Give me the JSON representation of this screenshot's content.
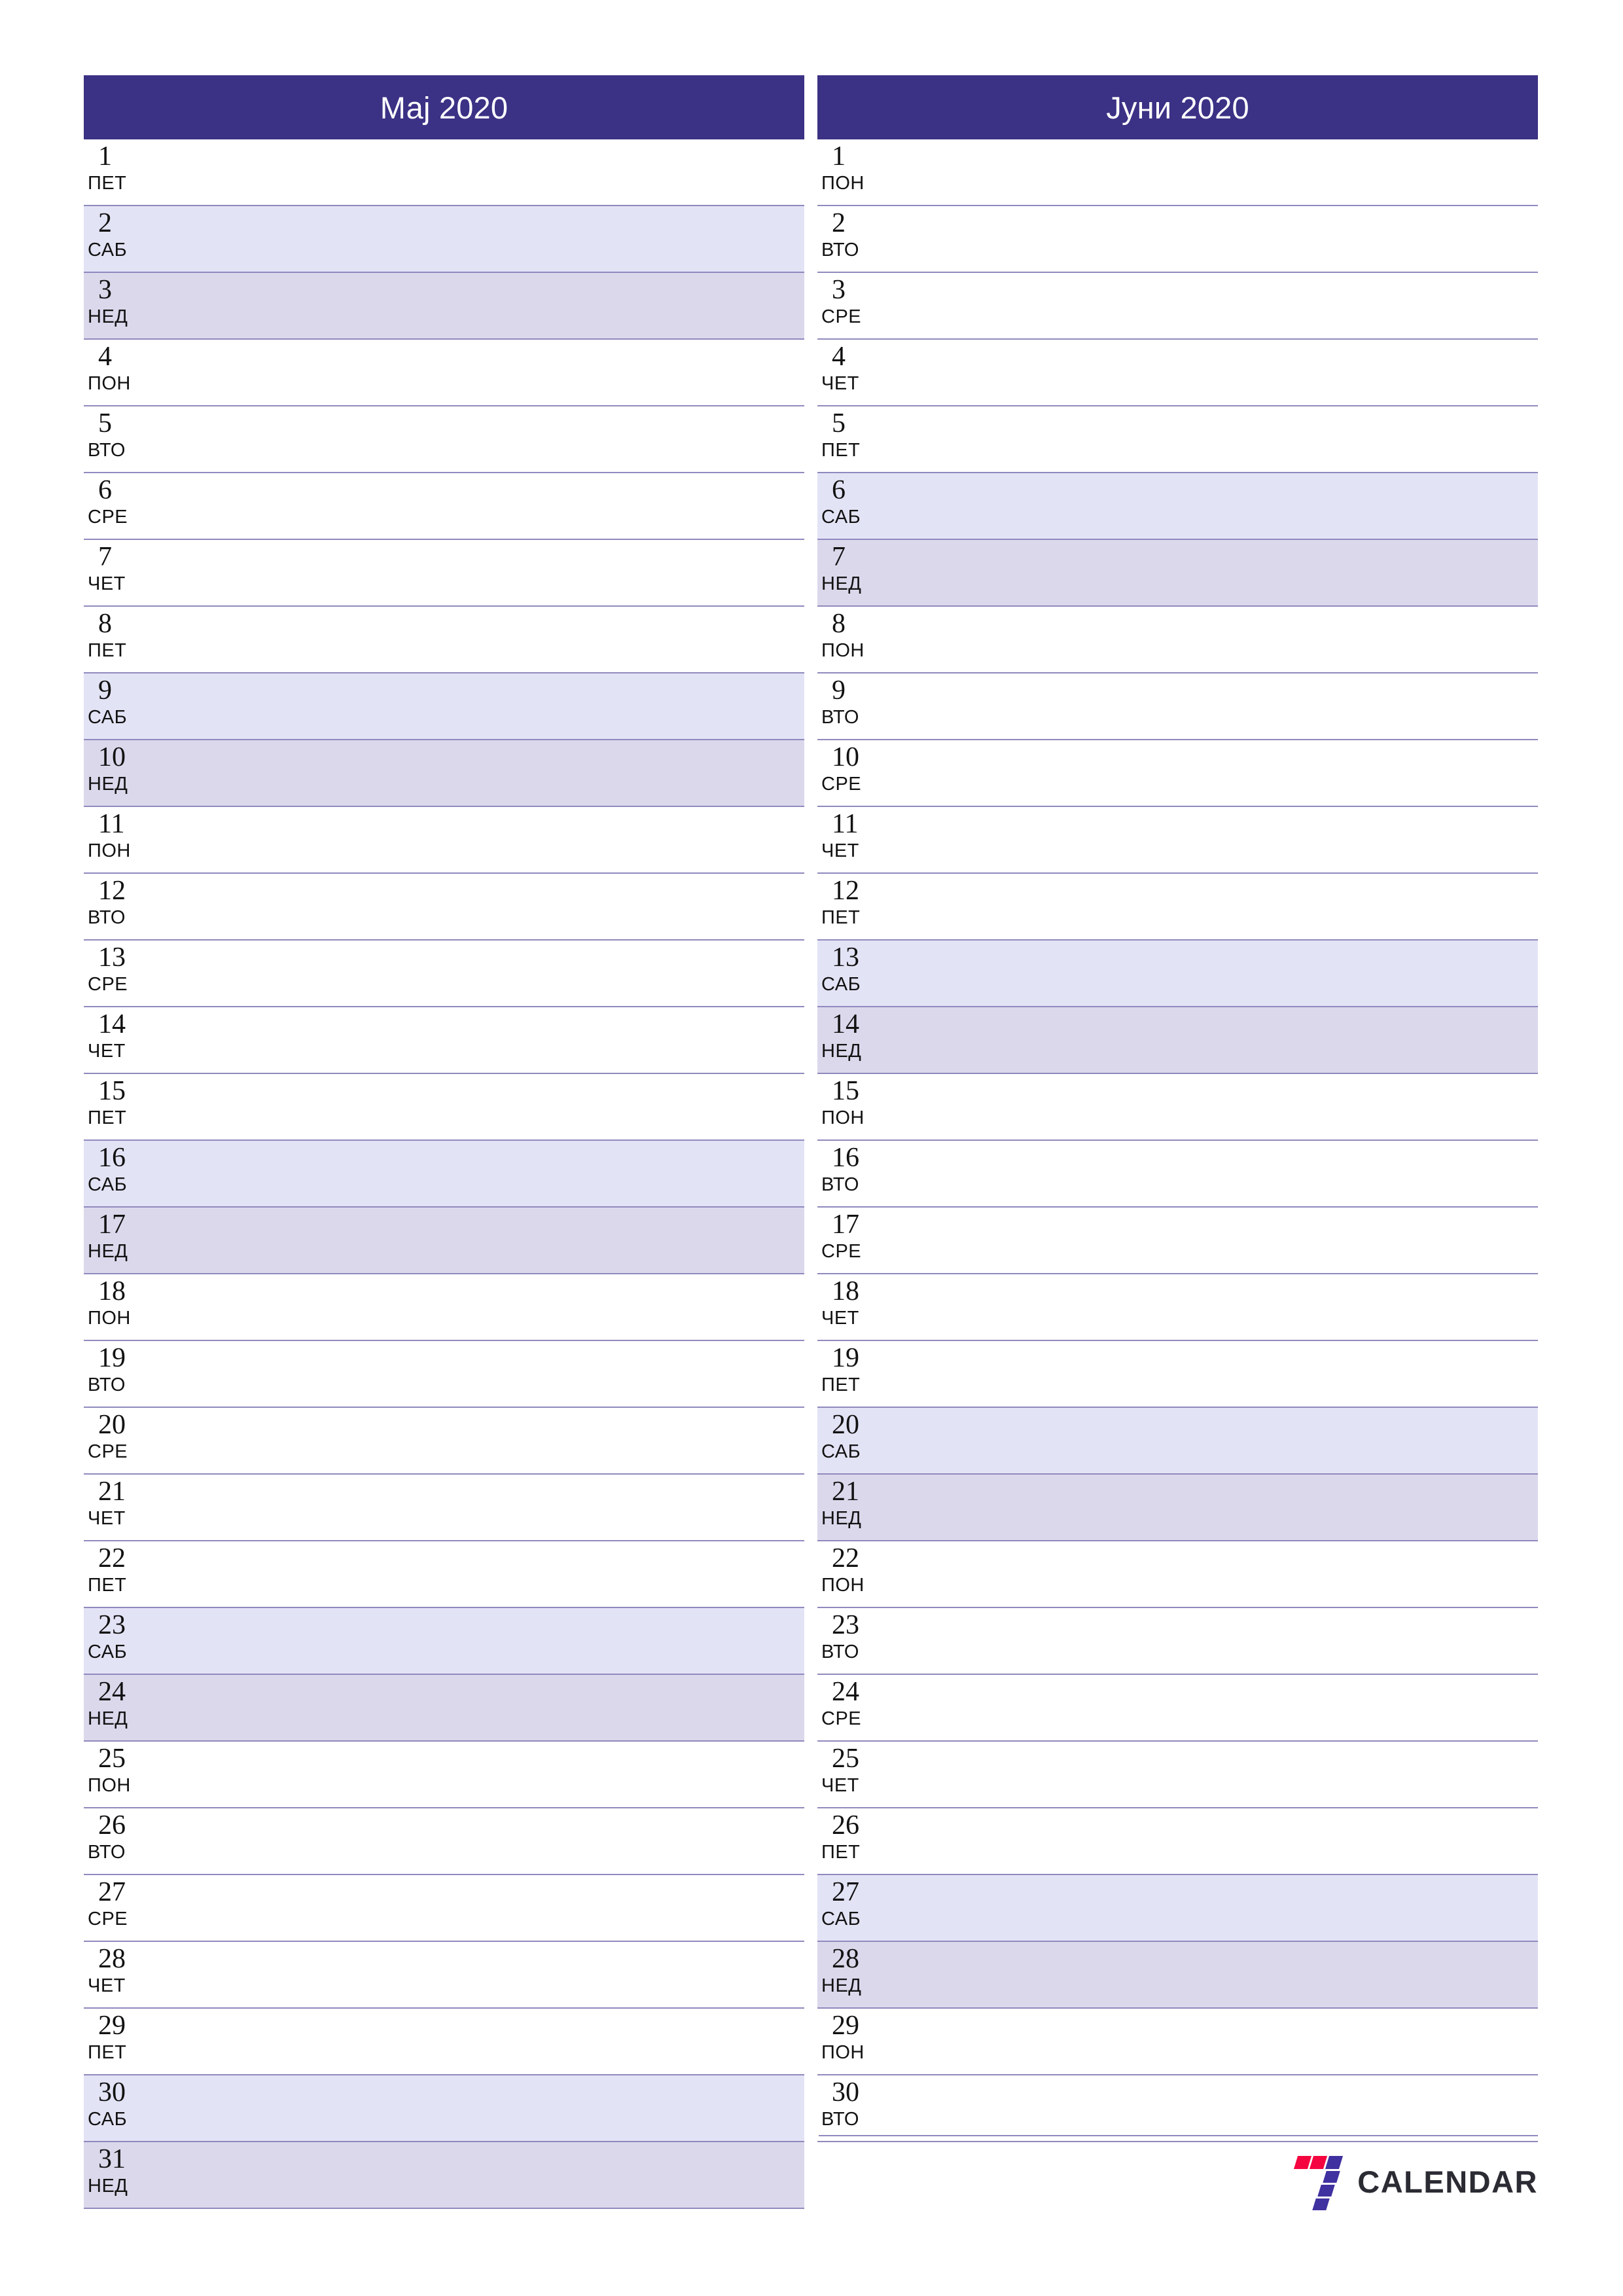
{
  "document": {
    "type": "two-month-planner",
    "year": "2020",
    "page_background": "#ffffff"
  },
  "colors": {
    "header_bg": "#3b3185",
    "header_text": "#ffffff",
    "row_border": "#8f8abd",
    "saturday_bg": "#e3e3f6",
    "sunday_bg": "#dcd8ec",
    "text": "#121212",
    "logo_red": "#f5053f",
    "logo_purple": "#3f31a0",
    "logo_wordmark": "#2b2b33"
  },
  "months": [
    {
      "name": "month-may",
      "title": "Мај 2020",
      "days": [
        {
          "num": "1",
          "abbr": "ПЕТ",
          "kind": "weekday"
        },
        {
          "num": "2",
          "abbr": "САБ",
          "kind": "sat"
        },
        {
          "num": "3",
          "abbr": "НЕД",
          "kind": "sun"
        },
        {
          "num": "4",
          "abbr": "ПОН",
          "kind": "weekday"
        },
        {
          "num": "5",
          "abbr": "ВТО",
          "kind": "weekday"
        },
        {
          "num": "6",
          "abbr": "СРЕ",
          "kind": "weekday"
        },
        {
          "num": "7",
          "abbr": "ЧЕТ",
          "kind": "weekday"
        },
        {
          "num": "8",
          "abbr": "ПЕТ",
          "kind": "weekday"
        },
        {
          "num": "9",
          "abbr": "САБ",
          "kind": "sat"
        },
        {
          "num": "10",
          "abbr": "НЕД",
          "kind": "sun"
        },
        {
          "num": "11",
          "abbr": "ПОН",
          "kind": "weekday"
        },
        {
          "num": "12",
          "abbr": "ВТО",
          "kind": "weekday"
        },
        {
          "num": "13",
          "abbr": "СРЕ",
          "kind": "weekday"
        },
        {
          "num": "14",
          "abbr": "ЧЕТ",
          "kind": "weekday"
        },
        {
          "num": "15",
          "abbr": "ПЕТ",
          "kind": "weekday"
        },
        {
          "num": "16",
          "abbr": "САБ",
          "kind": "sat"
        },
        {
          "num": "17",
          "abbr": "НЕД",
          "kind": "sun"
        },
        {
          "num": "18",
          "abbr": "ПОН",
          "kind": "weekday"
        },
        {
          "num": "19",
          "abbr": "ВТО",
          "kind": "weekday"
        },
        {
          "num": "20",
          "abbr": "СРЕ",
          "kind": "weekday"
        },
        {
          "num": "21",
          "abbr": "ЧЕТ",
          "kind": "weekday"
        },
        {
          "num": "22",
          "abbr": "ПЕТ",
          "kind": "weekday"
        },
        {
          "num": "23",
          "abbr": "САБ",
          "kind": "sat"
        },
        {
          "num": "24",
          "abbr": "НЕД",
          "kind": "sun"
        },
        {
          "num": "25",
          "abbr": "ПОН",
          "kind": "weekday"
        },
        {
          "num": "26",
          "abbr": "ВТО",
          "kind": "weekday"
        },
        {
          "num": "27",
          "abbr": "СРЕ",
          "kind": "weekday"
        },
        {
          "num": "28",
          "abbr": "ЧЕТ",
          "kind": "weekday"
        },
        {
          "num": "29",
          "abbr": "ПЕТ",
          "kind": "weekday"
        },
        {
          "num": "30",
          "abbr": "САБ",
          "kind": "sat"
        },
        {
          "num": "31",
          "abbr": "НЕД",
          "kind": "sun"
        }
      ]
    },
    {
      "name": "month-june",
      "title": "Јуни 2020",
      "days": [
        {
          "num": "1",
          "abbr": "ПОН",
          "kind": "weekday"
        },
        {
          "num": "2",
          "abbr": "ВТО",
          "kind": "weekday"
        },
        {
          "num": "3",
          "abbr": "СРЕ",
          "kind": "weekday"
        },
        {
          "num": "4",
          "abbr": "ЧЕТ",
          "kind": "weekday"
        },
        {
          "num": "5",
          "abbr": "ПЕТ",
          "kind": "weekday"
        },
        {
          "num": "6",
          "abbr": "САБ",
          "kind": "sat"
        },
        {
          "num": "7",
          "abbr": "НЕД",
          "kind": "sun"
        },
        {
          "num": "8",
          "abbr": "ПОН",
          "kind": "weekday"
        },
        {
          "num": "9",
          "abbr": "ВТО",
          "kind": "weekday"
        },
        {
          "num": "10",
          "abbr": "СРЕ",
          "kind": "weekday"
        },
        {
          "num": "11",
          "abbr": "ЧЕТ",
          "kind": "weekday"
        },
        {
          "num": "12",
          "abbr": "ПЕТ",
          "kind": "weekday"
        },
        {
          "num": "13",
          "abbr": "САБ",
          "kind": "sat"
        },
        {
          "num": "14",
          "abbr": "НЕД",
          "kind": "sun"
        },
        {
          "num": "15",
          "abbr": "ПОН",
          "kind": "weekday"
        },
        {
          "num": "16",
          "abbr": "ВТО",
          "kind": "weekday"
        },
        {
          "num": "17",
          "abbr": "СРЕ",
          "kind": "weekday"
        },
        {
          "num": "18",
          "abbr": "ЧЕТ",
          "kind": "weekday"
        },
        {
          "num": "19",
          "abbr": "ПЕТ",
          "kind": "weekday"
        },
        {
          "num": "20",
          "abbr": "САБ",
          "kind": "sat"
        },
        {
          "num": "21",
          "abbr": "НЕД",
          "kind": "sun"
        },
        {
          "num": "22",
          "abbr": "ПОН",
          "kind": "weekday"
        },
        {
          "num": "23",
          "abbr": "ВТО",
          "kind": "weekday"
        },
        {
          "num": "24",
          "abbr": "СРЕ",
          "kind": "weekday"
        },
        {
          "num": "25",
          "abbr": "ЧЕТ",
          "kind": "weekday"
        },
        {
          "num": "26",
          "abbr": "ПЕТ",
          "kind": "weekday"
        },
        {
          "num": "27",
          "abbr": "САБ",
          "kind": "sat"
        },
        {
          "num": "28",
          "abbr": "НЕД",
          "kind": "sun"
        },
        {
          "num": "29",
          "abbr": "ПОН",
          "kind": "weekday"
        },
        {
          "num": "30",
          "abbr": "ВТО",
          "kind": "weekday"
        }
      ]
    }
  ],
  "footer": {
    "brand_name": "CALENDAR",
    "logo_icon": "seven-calendar-logo-icon"
  }
}
